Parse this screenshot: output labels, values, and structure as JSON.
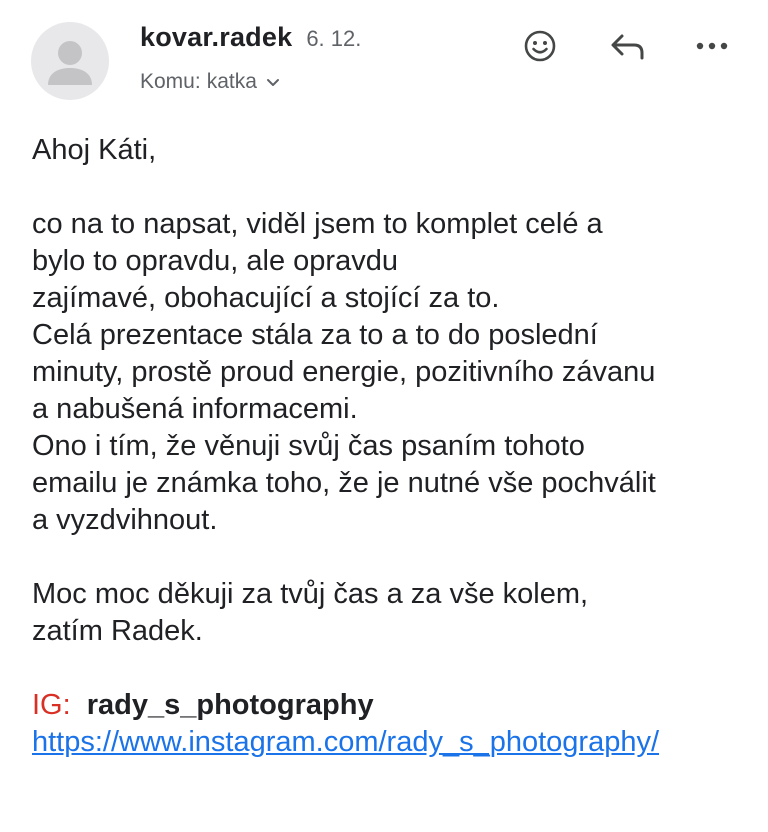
{
  "header": {
    "sender_name": "kovar.radek",
    "date": "6. 12.",
    "recipient_label": "Komu:",
    "recipient_name": "katka",
    "icons": {
      "emoji": "smiley-face-icon",
      "reply": "reply-arrow-icon",
      "more": "more-options-icon",
      "expand": "chevron-down-icon",
      "avatar": "person-placeholder-icon"
    }
  },
  "body": {
    "greeting": "Ahoj Káti,",
    "paragraph1_lines": [
      "co na to napsat, viděl jsem to komplet celé a",
      "bylo to opravdu, ale opravdu",
      "zajímavé, obohacující a stojící za to.",
      "Celá prezentace stála za to a to do poslední",
      "minuty, prostě proud energie, pozitivního závanu",
      "a nabušená informacemi.",
      "Ono i tím, že věnuji svůj čas psaním tohoto",
      "emailu je známka toho, že je nutné vše pochválit",
      "a vyzdvihnout."
    ],
    "paragraph2_lines": [
      "Moc moc děkuji za tvůj čas a za vše kolem,",
      "zatím Radek."
    ],
    "signature": {
      "ig_label": "IG:",
      "ig_handle": "rady_s_photography",
      "link": "https://www.instagram.com/rady_s_photography/"
    }
  },
  "colors": {
    "text": "#202124",
    "secondary": "#5f6368",
    "ig_label": "#d93025",
    "link": "#1a73e8",
    "avatar_bg": "#e8e8ea"
  }
}
